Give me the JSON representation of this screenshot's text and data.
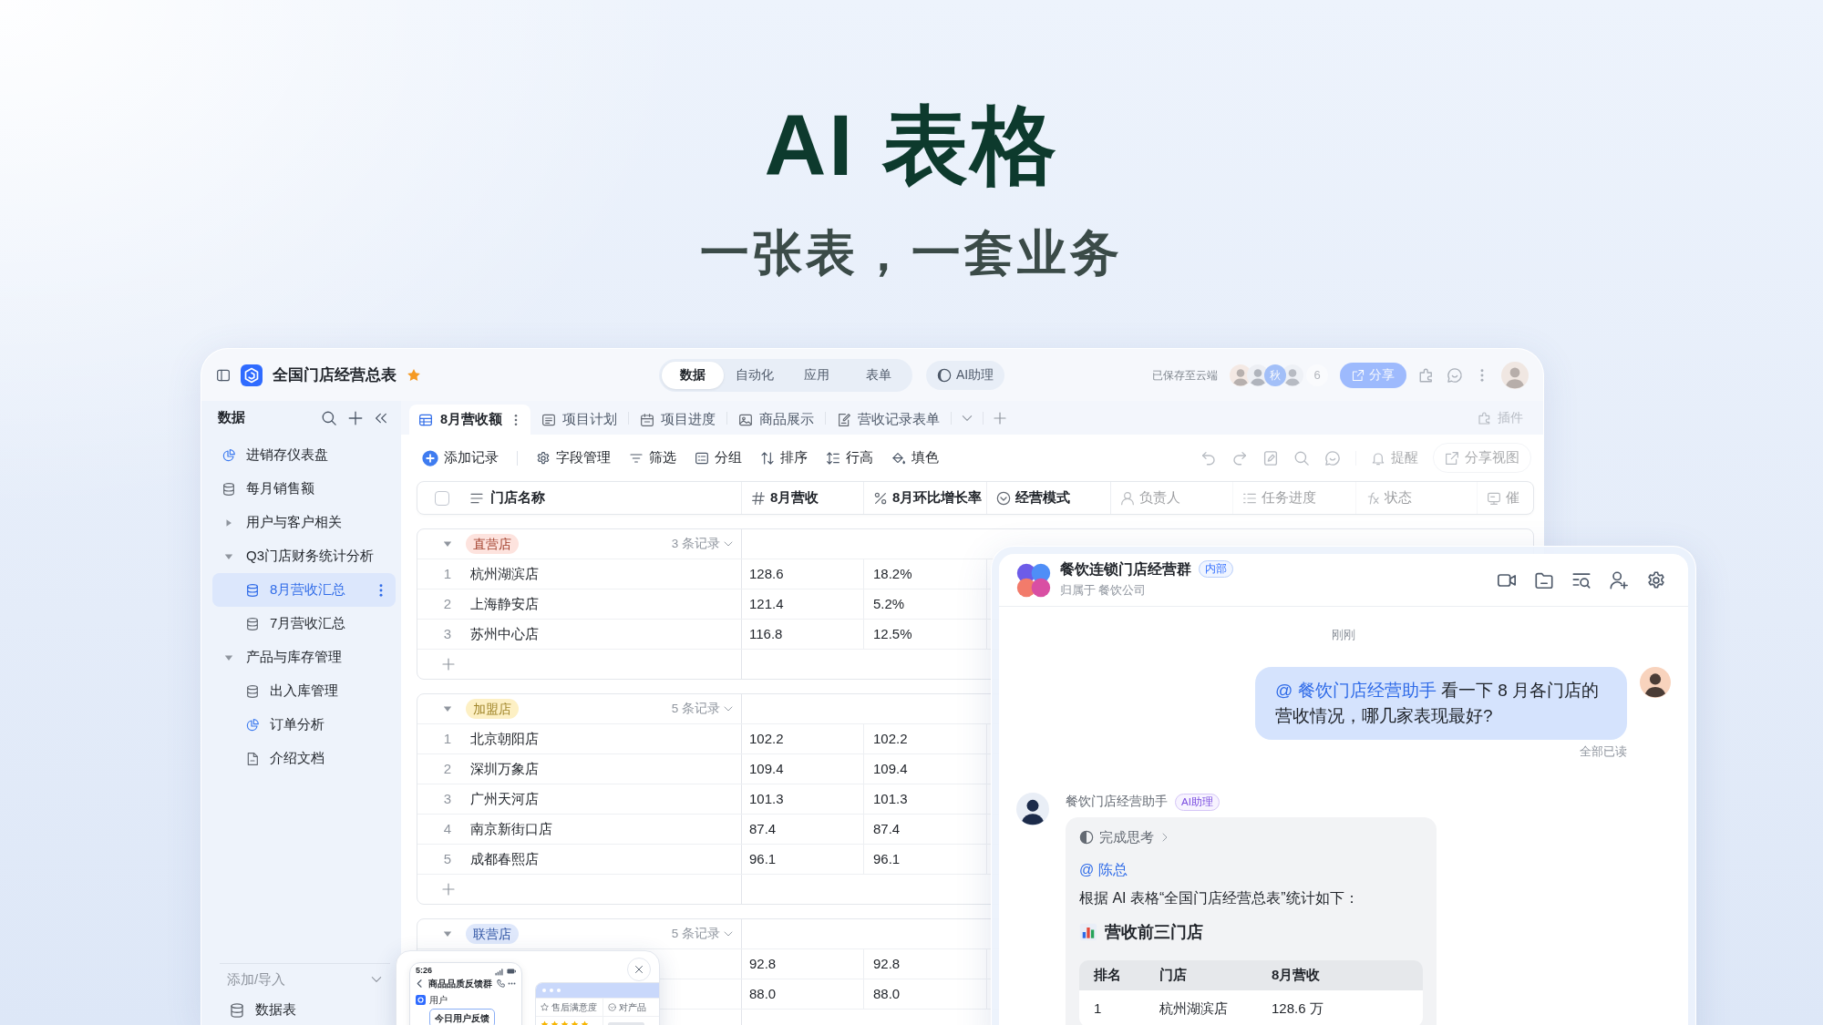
{
  "hero": {
    "title": "AI 表格",
    "subtitle": "一张表，一套业务"
  },
  "titlebar": {
    "title": "全国门店经营总表",
    "starred": true,
    "modes": [
      {
        "label": "数据",
        "selected": true
      },
      {
        "label": "自动化",
        "selected": false
      },
      {
        "label": "应用",
        "selected": false
      },
      {
        "label": "表单",
        "selected": false
      }
    ],
    "assistant": "AI助理",
    "save_status": "已保存至云端",
    "collaborators": [
      {
        "kind": "photo"
      },
      {
        "kind": "photo"
      },
      {
        "kind": "initial",
        "initial": "秋"
      },
      {
        "kind": "photo"
      }
    ],
    "collaborator_count": "6",
    "share": "分享"
  },
  "sidebar": {
    "title": "数据",
    "items": [
      {
        "label": "进销存仪表盘",
        "kind": "dashboard",
        "selected": false
      },
      {
        "label": "每月销售额",
        "kind": "table",
        "selected": false
      },
      {
        "label": "用户与客户相关",
        "kind": "folder",
        "expanded": false,
        "selected": false
      },
      {
        "label": "Q3门店财务统计分析",
        "kind": "folder",
        "expanded": true,
        "selected": false,
        "children": [
          {
            "label": "8月营收汇总",
            "kind": "table",
            "selected": true
          },
          {
            "label": "7月营收汇总",
            "kind": "table",
            "selected": false
          }
        ]
      },
      {
        "label": "产品与库存管理",
        "kind": "folder",
        "expanded": true,
        "selected": false,
        "children": [
          {
            "label": "出入库管理",
            "kind": "table",
            "selected": false
          },
          {
            "label": "订单分析",
            "kind": "dashboard",
            "selected": false
          },
          {
            "label": "介绍文档",
            "kind": "doc",
            "selected": false
          }
        ]
      }
    ],
    "add_menu": "添加/导入",
    "add_options": [
      {
        "label": "数据表",
        "kind": "table"
      }
    ]
  },
  "view_tabs": [
    {
      "label": "8月营收额",
      "kind": "grid",
      "selected": true
    },
    {
      "label": "项目计划",
      "kind": "gantt",
      "selected": false
    },
    {
      "label": "项目进度",
      "kind": "calendar",
      "selected": false
    },
    {
      "label": "商品展示",
      "kind": "gallery",
      "selected": false
    },
    {
      "label": "营收记录表单",
      "kind": "form",
      "selected": false
    }
  ],
  "plugins": "插件",
  "toolbar": {
    "actions": [
      {
        "label": "添加记录",
        "kind": "add"
      },
      {
        "label": "字段管理",
        "kind": "fields"
      },
      {
        "label": "筛选",
        "kind": "filter"
      },
      {
        "label": "分组",
        "kind": "group"
      },
      {
        "label": "排序",
        "kind": "sort"
      },
      {
        "label": "行高",
        "kind": "row_height"
      },
      {
        "label": "填色",
        "kind": "fill"
      }
    ],
    "reminder": "提醒",
    "share_view": "分享视图"
  },
  "table": {
    "select_all": {
      "checked": false
    },
    "columns": [
      {
        "label": "门店名称",
        "kind": "text"
      },
      {
        "label": "8月营收",
        "kind": "number"
      },
      {
        "label": "8月环比增长率",
        "kind": "percent"
      },
      {
        "label": "经营模式",
        "kind": "select"
      },
      {
        "label": "负责人",
        "kind": "person"
      },
      {
        "label": "任务进度",
        "kind": "checklist"
      },
      {
        "label": "状态",
        "kind": "formula"
      },
      {
        "label": "催",
        "kind": "reminder"
      }
    ],
    "groups": [
      {
        "label": "直营店",
        "color": "#fde3de",
        "expanded": true,
        "count": "3 条记录",
        "rows": [
          {
            "index": "1",
            "name": "杭州湖滨店",
            "revenue": "128.6",
            "growth": "18.2%"
          },
          {
            "index": "2",
            "name": "上海静安店",
            "revenue": "121.4",
            "growth": "5.2%"
          },
          {
            "index": "3",
            "name": "苏州中心店",
            "revenue": "116.8",
            "growth": "12.5%"
          }
        ]
      },
      {
        "label": "加盟店",
        "color": "#fdf0c4",
        "expanded": true,
        "count": "5 条记录",
        "rows": [
          {
            "index": "1",
            "name": "北京朝阳店",
            "revenue": "102.2",
            "growth": "102.2"
          },
          {
            "index": "2",
            "name": "深圳万象店",
            "revenue": "109.4",
            "growth": "109.4"
          },
          {
            "index": "3",
            "name": "广州天河店",
            "revenue": "101.3",
            "growth": "101.3"
          },
          {
            "index": "4",
            "name": "南京新街口店",
            "revenue": "87.4",
            "growth": "87.4"
          },
          {
            "index": "5",
            "name": "成都春熙店",
            "revenue": "96.1",
            "growth": "96.1"
          }
        ]
      },
      {
        "label": "联营店",
        "color": "#dfe8fb",
        "expanded": true,
        "count": "5 条记录",
        "rows": [
          {
            "revenue": "92.8",
            "growth": "92.8"
          },
          {
            "revenue": "88.0",
            "growth": "88.0"
          }
        ]
      }
    ]
  },
  "chat": {
    "title": "餐饮连锁门店经营群",
    "badge": "内部",
    "subtitle": "归属于 餐饮公司",
    "time": "刚刚",
    "messages": [
      {
        "kind": "outgoing",
        "mention": "@ 餐饮门店经营助手",
        "text": "看一下 8 月各门店的营收情况，哪几家表现最好?",
        "receipt": "全部已读"
      },
      {
        "kind": "incoming",
        "sender": "餐饮门店经营助手",
        "badge": "AI助理",
        "thinking": "完成思考",
        "mention": "@ 陈总",
        "text": "根据 AI 表格“全国门店经营总表”统计如下：",
        "heading": "营收前三门店",
        "table": {
          "columns": [
            "排名",
            "门店",
            "8月营收"
          ],
          "rows": [
            [
              "1",
              "杭州湖滨店",
              "128.6 万"
            ]
          ]
        }
      }
    ]
  },
  "preview": {
    "phone": {
      "time": "5:26",
      "title": "商品品质反馈群",
      "sender": "用户",
      "card_title": "今日用户反馈"
    },
    "sheet": {
      "columns": [
        {
          "label": "售后满意度",
          "kind": "rating"
        },
        {
          "label": "对产品",
          "kind": "select"
        }
      ],
      "stars": 5
    }
  }
}
